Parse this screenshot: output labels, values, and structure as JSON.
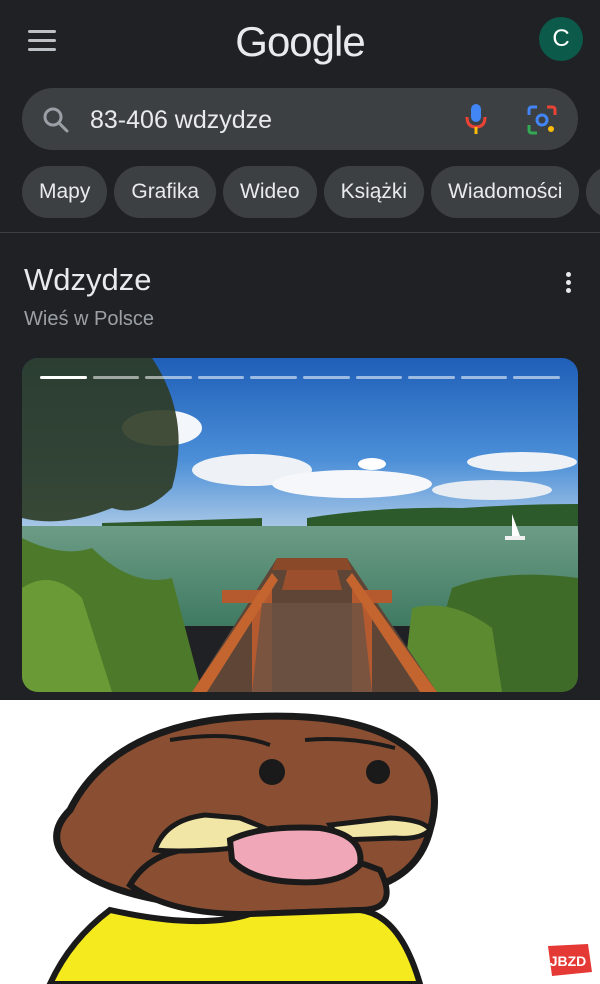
{
  "header": {
    "logo_text": "Google",
    "avatar_initial": "C"
  },
  "search": {
    "query": "83-406 wdzydze"
  },
  "chips": [
    "Mapy",
    "Grafika",
    "Wideo",
    "Książki",
    "Wiadomości"
  ],
  "result": {
    "title": "Wdzydze",
    "subtitle": "Wieś w Polsce",
    "gallery": {
      "total_slides": 10,
      "active_slide": 1
    }
  },
  "meme": {
    "watermark_text": "JBZD"
  },
  "colors": {
    "background": "#202124",
    "chip_bg": "#3c4043",
    "text_primary": "#e8eaed",
    "text_secondary": "#9aa0a6",
    "avatar_bg": "#0b5a4a",
    "watermark": "#e53935"
  }
}
